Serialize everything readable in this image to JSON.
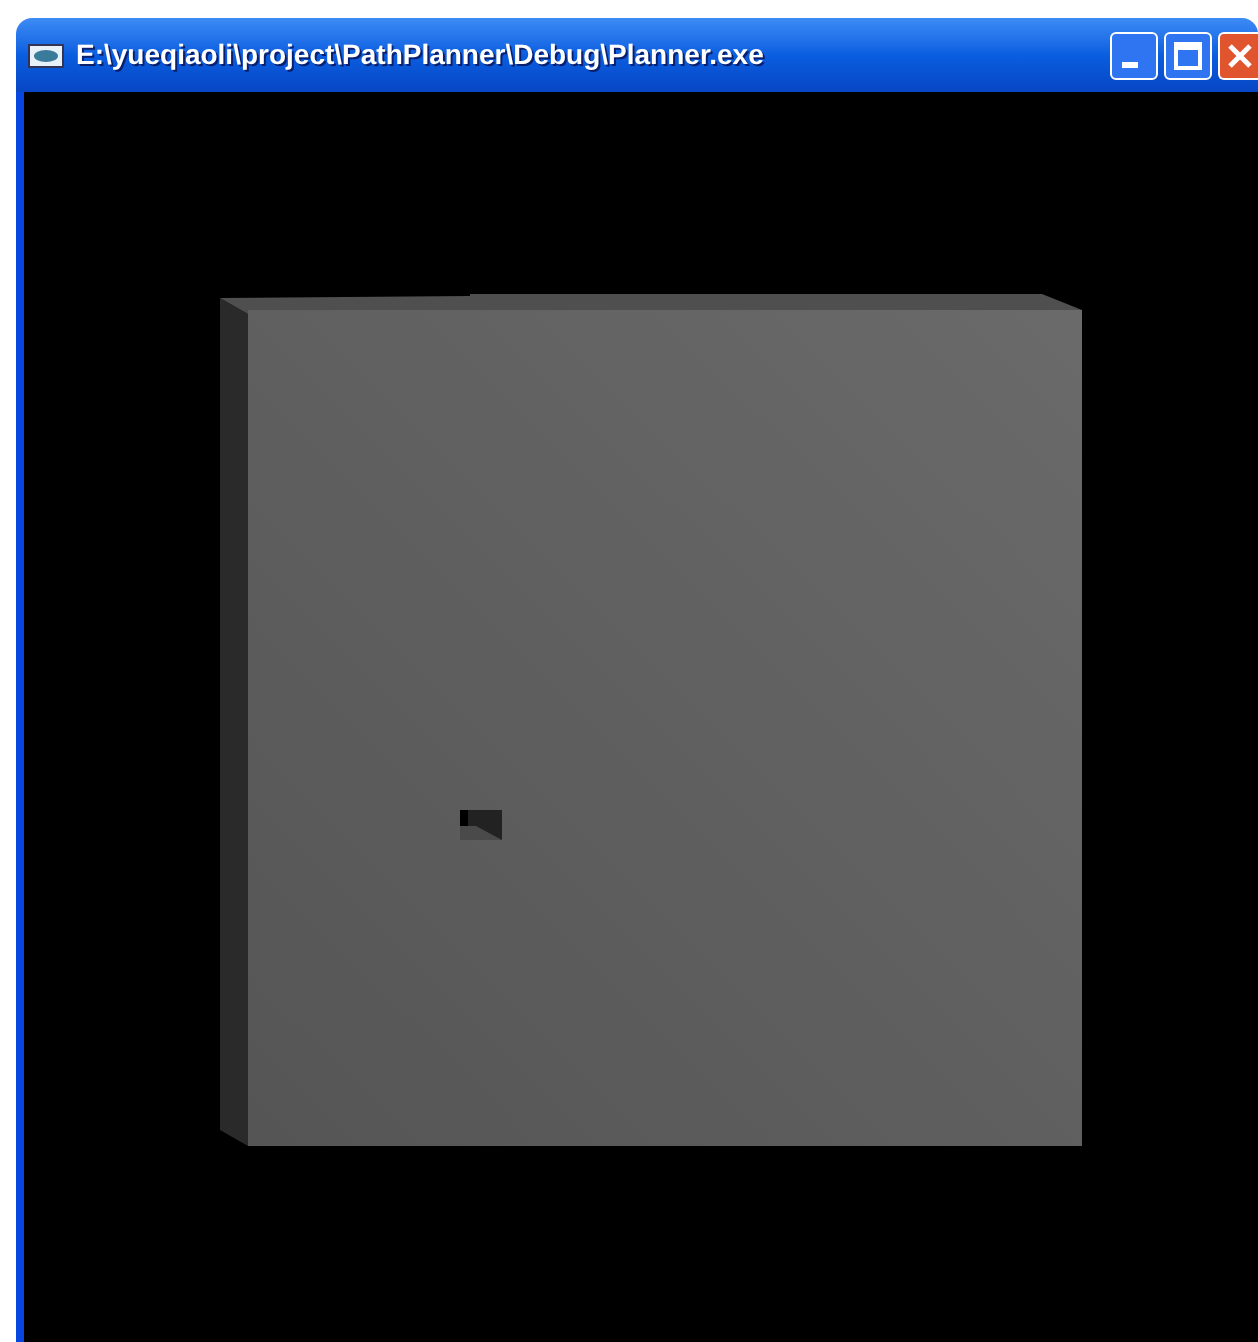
{
  "window": {
    "title": "E:\\yueqiaoli\\project\\PathPlanner\\Debug\\Planner.exe"
  }
}
